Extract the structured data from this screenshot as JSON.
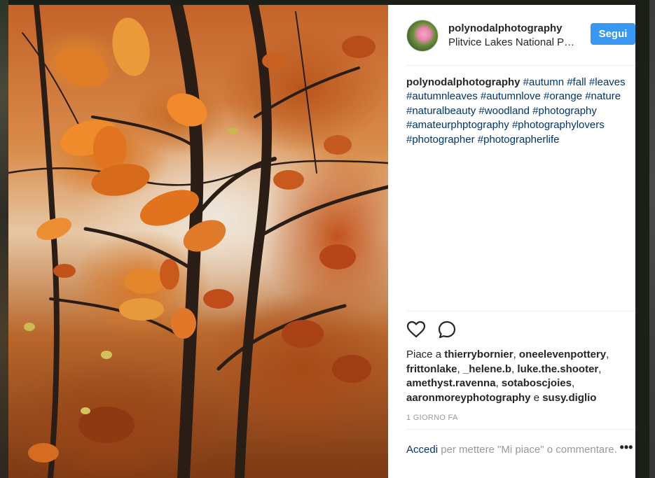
{
  "post": {
    "username": "polynodalphotography",
    "location": "Plitvice Lakes National Park",
    "follow_label": "Segui",
    "caption_author": "polynodalphotography",
    "hashtags": [
      "#autumn",
      "#fall",
      "#leaves",
      "#autumnleaves",
      "#autumnlove",
      "#orange",
      "#nature",
      "#naturalbeauty",
      "#woodland",
      "#photography",
      "#amateurphptography",
      "#photographylovers",
      "#photographer",
      "#photographerlife"
    ],
    "likes_prefix": "Piace a",
    "liked_by": [
      "thierrybornier",
      "oneelevenpottery",
      "frittonlake",
      "_helene.b",
      "luke.the.shooter",
      "amethyst.ravenna",
      "sotaboscjoies",
      "aaronmoreyphotography"
    ],
    "likes_conjunction": "e",
    "liked_last": "susy.diglio",
    "time_ago": "1 GIORNO FA",
    "login_link": "Accedi",
    "login_text": "per mettere \"Mi piace\" o commentare.",
    "more_label": "•••"
  },
  "icons": {
    "like": "heart-outline-icon",
    "comment": "speech-bubble-icon",
    "more": "ellipsis-icon"
  },
  "colors": {
    "follow_button": "#3897f0",
    "hashtag": "#003569",
    "muted": "#999999"
  }
}
